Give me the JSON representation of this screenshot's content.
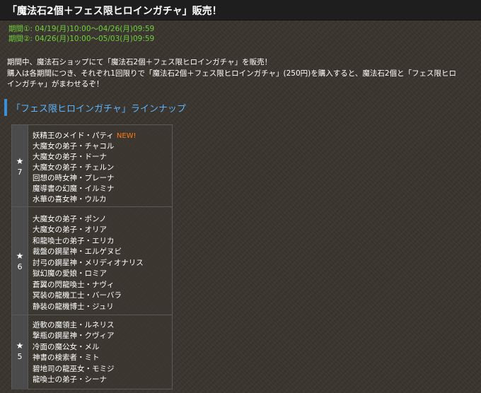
{
  "header": {
    "title": "「魔法石2個＋フェス限ヒロインガチャ」販売！"
  },
  "periods": [
    "期間①: 04/19(月)10:00〜04/26(月)09:59",
    "期間②: 04/26(月)10:00〜05/03(月)09:59"
  ],
  "description": [
    "期間中、魔法石ショップにて「魔法石2個＋フェス限ヒロインガチャ」を販売！",
    "購入は各期間につき、それぞれ1回限りで「魔法石2個＋フェス限ヒロインガチャ」(250円)を購入すると、魔法石2個と「フェス限ヒロ",
    "インガチャ」がまわせるぞ！"
  ],
  "lineup": {
    "heading": "「フェス限ヒロインガチャ」ラインナップ",
    "star_symbol": "★",
    "new_label": "NEW!",
    "groups": [
      {
        "rarity": "7",
        "characters": [
          "妖精王のメイド・パティ",
          "大魔女の弟子・チャコル",
          "大魔女の弟子・ドーナ",
          "大魔女の弟子・チェルン",
          "回想の時女神・プレーナ",
          "魔導書の幻魔・イルミナ",
          "水華の喜女神・ウルカ"
        ]
      },
      {
        "rarity": "6",
        "characters": [
          "大魔女の弟子・ポンノ",
          "大魔女の弟子・オリア",
          "和龍喚士の弟子・エリカ",
          "裁盤の鋼星神・エルゲヌビ",
          "討弓の鋼星神・メリディオナリス",
          "獄幻魔の愛娘・ロミア",
          "蒼翼の閃龍喚士・ナヴィ",
          "冥装の龍機工士・バーバラ",
          "静装の龍機博士・ジュリ"
        ]
      },
      {
        "rarity": "5",
        "characters": [
          "遊軟の魔領主・ルネリス",
          "撃瓶の鋼星神・クヴィア",
          "冷面の魔公女・メル",
          "神書の検索者・ミト",
          "碧地司の龍巫女・モミジ",
          "龍喚士の弟子・シーナ"
        ]
      }
    ]
  }
}
